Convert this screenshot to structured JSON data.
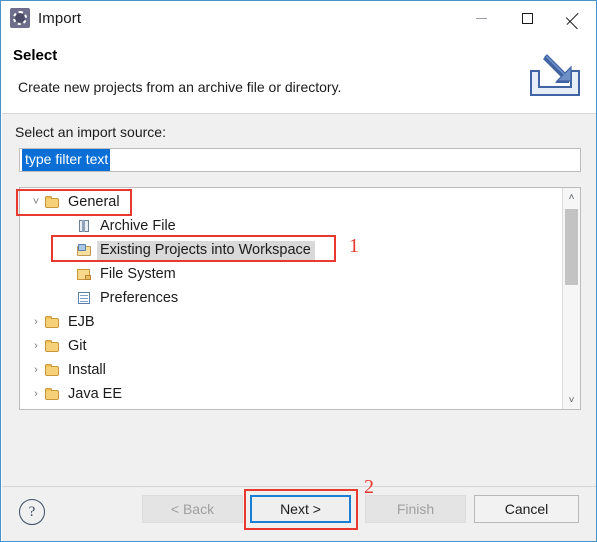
{
  "window": {
    "title": "Import",
    "icon": "import-wizard-icon",
    "controls": {
      "minimize": "minimize-icon",
      "maximize": "maximize-icon",
      "close": "close-icon"
    }
  },
  "header": {
    "title": "Select",
    "description": "Create new projects from an archive file or directory.",
    "banner_icon": "import-banner-icon"
  },
  "body": {
    "label": "Select an import source:",
    "filter": {
      "value": "type filter text",
      "selected": true
    },
    "tree": [
      {
        "label": "General",
        "level": 0,
        "twisty": "˅",
        "icon": "folder-open-icon",
        "selected": false,
        "annotated": true
      },
      {
        "label": "Archive File",
        "level": 1,
        "twisty": "",
        "icon": "archive-file-icon",
        "selected": false,
        "annotated": false
      },
      {
        "label": "Existing Projects into Workspace",
        "level": 1,
        "twisty": "",
        "icon": "existing-projects-icon",
        "selected": true,
        "annotated": true
      },
      {
        "label": "File System",
        "level": 1,
        "twisty": "",
        "icon": "file-system-folder-icon",
        "selected": false,
        "annotated": false
      },
      {
        "label": "Preferences",
        "level": 1,
        "twisty": "",
        "icon": "preferences-icon",
        "selected": false,
        "annotated": false
      },
      {
        "label": "EJB",
        "level": 0,
        "twisty": "›",
        "icon": "folder-open-icon",
        "selected": false,
        "annotated": false
      },
      {
        "label": "Git",
        "level": 0,
        "twisty": "›",
        "icon": "folder-open-icon",
        "selected": false,
        "annotated": false
      },
      {
        "label": "Install",
        "level": 0,
        "twisty": "›",
        "icon": "folder-open-icon",
        "selected": false,
        "annotated": false
      },
      {
        "label": "Java EE",
        "level": 0,
        "twisty": "›",
        "icon": "folder-open-icon",
        "selected": false,
        "annotated": false
      }
    ],
    "scrollbar": {
      "up_arrow": "˄",
      "down_arrow": "˅"
    }
  },
  "footer": {
    "help_label": "?",
    "buttons": {
      "back": {
        "label": "< Back",
        "enabled": false
      },
      "next": {
        "label": "Next >",
        "enabled": true,
        "focused": true
      },
      "finish": {
        "label": "Finish",
        "enabled": false
      },
      "cancel": {
        "label": "Cancel",
        "enabled": true
      }
    }
  },
  "annotations": {
    "step1": "1",
    "step2": "2",
    "color": "#e8392e"
  }
}
